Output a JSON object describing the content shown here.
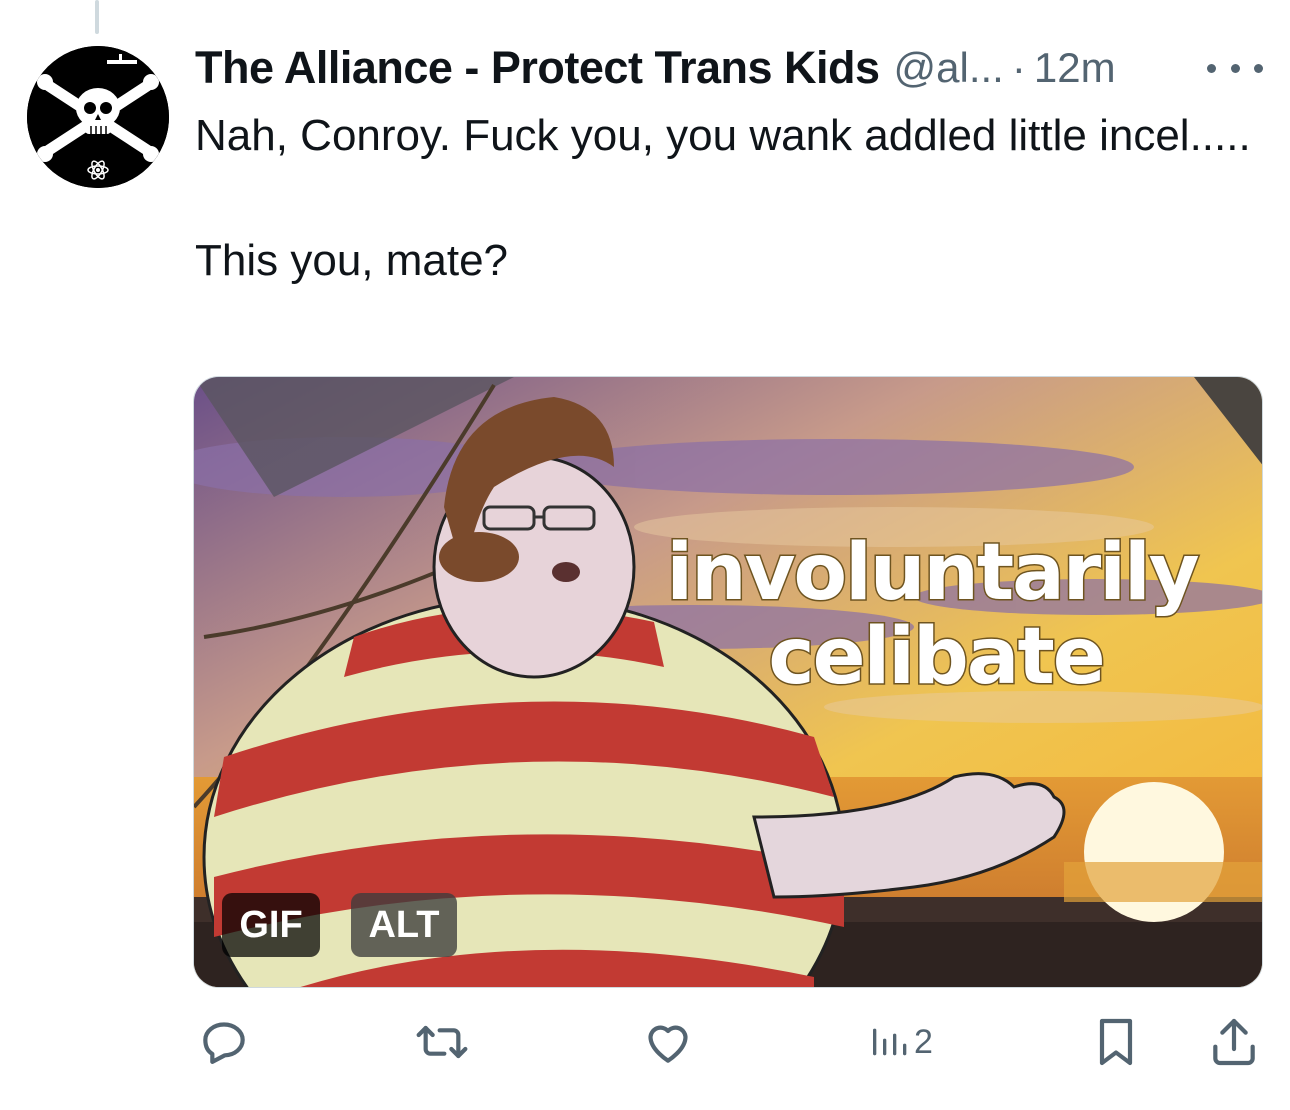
{
  "tweet": {
    "display_name": "The Alliance - Protect Trans Kids",
    "handle": "@al...",
    "separator": "·",
    "time": "12m",
    "text_line1": "Nah, Conroy.  Fuck you, you wank addled little incel.....",
    "text_line2": "This you, mate?"
  },
  "media": {
    "caption_line1": "involuntarily",
    "caption_line2": "celibate",
    "badges": {
      "gif": "GIF",
      "alt": "ALT"
    }
  },
  "actions": {
    "reply_icon": "reply-icon",
    "retweet_icon": "retweet-icon",
    "like_icon": "like-icon",
    "views_icon": "views-icon",
    "views_count": "2",
    "bookmark_icon": "bookmark-icon",
    "share_icon": "share-icon"
  },
  "colors": {
    "text": "#0f1419",
    "secondary": "#536471",
    "icon": "#536471"
  }
}
